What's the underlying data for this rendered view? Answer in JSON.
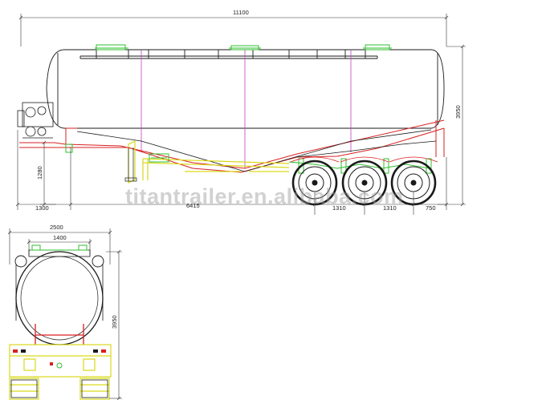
{
  "dimensions": {
    "overall_length": "11100",
    "height_side": "3950",
    "height_rear": "3950",
    "ground_clearance": "1280",
    "front_overhang": "1300",
    "wheelbase": "6415",
    "axle_spacing_1": "1310",
    "axle_spacing_2": "1310",
    "rear_overhang": "750",
    "overall_width": "2500",
    "axle_track": "1400"
  },
  "watermark": "titantrailer.en.alibaba.com",
  "colors": {
    "outline": "#1a1a1a",
    "frame_red": "#d92020",
    "fitting_green": "#2fbf2f",
    "chassis_yellow": "#d9d91a",
    "divider_magenta": "#c040c0",
    "dimension_line": "#333333"
  }
}
